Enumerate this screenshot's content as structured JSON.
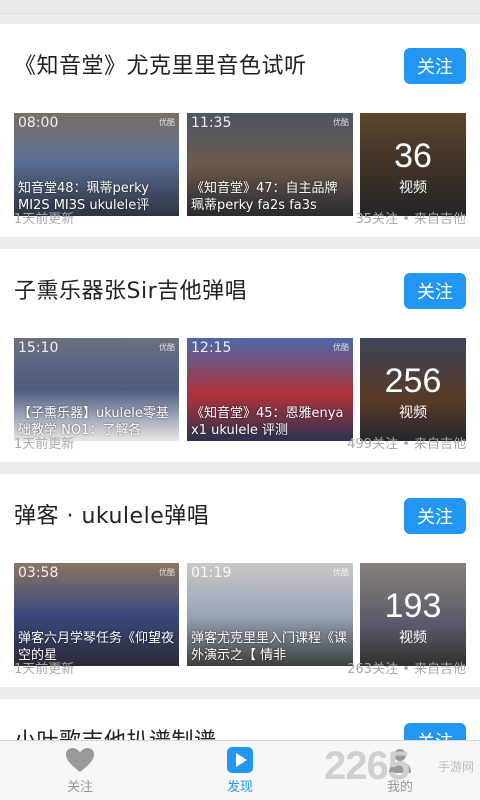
{
  "channels": [
    {
      "title": "《知音堂》尤克里里音色试听",
      "follow_label": "关注",
      "videos": [
        {
          "duration": "08:00",
          "watermark": "优酷",
          "caption": "知音堂48：珮蒂perky MI2S MI3S ukulele评"
        },
        {
          "duration": "11:35",
          "watermark": "优酷",
          "caption": "《知音堂》47：自主品牌珮蒂perky fa2s fa3s"
        }
      ],
      "more_count": "36",
      "more_label": "视频",
      "updated": "1天前更新",
      "meta": "35关注 • 来自吉他"
    },
    {
      "title": "子熏乐器张Sir吉他弹唱",
      "follow_label": "关注",
      "videos": [
        {
          "duration": "15:10",
          "watermark": "优酷",
          "caption": "【子熏乐器】ukulele零基础教学 NO1：了解各"
        },
        {
          "duration": "12:15",
          "watermark": "优酷",
          "caption": "《知音堂》45：恩雅enya x1 ukulele 评测"
        }
      ],
      "more_count": "256",
      "more_label": "视频",
      "updated": "1天前更新",
      "meta": "499关注 • 来自吉他"
    },
    {
      "title": "弹客 · ukulele弹唱",
      "follow_label": "关注",
      "videos": [
        {
          "duration": "03:58",
          "watermark": "优酷",
          "caption": "弹客六月学琴任务《仰望夜空的星"
        },
        {
          "duration": "01:19",
          "watermark": "优酷",
          "caption": "弹客尤克里里入门课程《课外演示之【 情非"
        }
      ],
      "more_count": "193",
      "more_label": "视频",
      "updated": "1天前更新",
      "meta": "263关注 • 来自吉他"
    },
    {
      "title": "小叶歌吉他扒谱制谱",
      "follow_label": "关注"
    }
  ],
  "tabs": [
    {
      "label": "关注",
      "icon": "heart-icon"
    },
    {
      "label": "发现",
      "icon": "play-icon"
    },
    {
      "label": "我的",
      "icon": "user-icon"
    }
  ],
  "watermark": {
    "big": "2265",
    "small": "手游网"
  },
  "colors": {
    "accent": "#2196f3",
    "meta_text": "#aaaaaa",
    "tab_inactive": "#999999"
  }
}
